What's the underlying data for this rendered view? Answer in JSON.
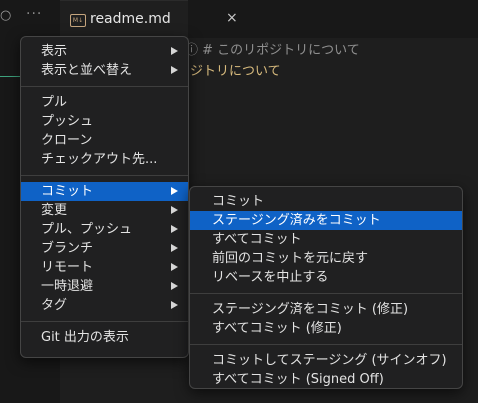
{
  "tab": {
    "icon": "markdown-icon",
    "icon_text": "M↓",
    "name": "readme.md",
    "close": "×"
  },
  "left": {
    "more": "···",
    "dot": "○"
  },
  "breadcrumb": "ⓘ # このリポジトリについて",
  "editor": {
    "line": "ジトリについて"
  },
  "main_menu": {
    "group1": [
      "表示",
      "表示と並べ替え"
    ],
    "group2": [
      "プル",
      "プッシュ",
      "クローン",
      "チェックアウト先..."
    ],
    "group3": [
      "コミット",
      "変更",
      "プル、プッシュ",
      "ブランチ",
      "リモート",
      "一時退避",
      "タグ"
    ],
    "group4": [
      "Git 出力の表示"
    ]
  },
  "sub_menu": {
    "group1": [
      "コミット",
      "ステージング済みをコミット",
      "すべてコミット",
      "前回のコミットを元に戻す",
      "リベースを中止する"
    ],
    "group2": [
      "ステージング済をコミット (修正)",
      "すべてコミット (修正)"
    ],
    "group3": [
      "コミットしてステージング (サインオフ)",
      "すべてコミット (Signed Off)"
    ]
  },
  "colors": {
    "accent": "#0f62c6",
    "menu_bg": "#202021",
    "heading_yellow": "#d7ba7d"
  }
}
